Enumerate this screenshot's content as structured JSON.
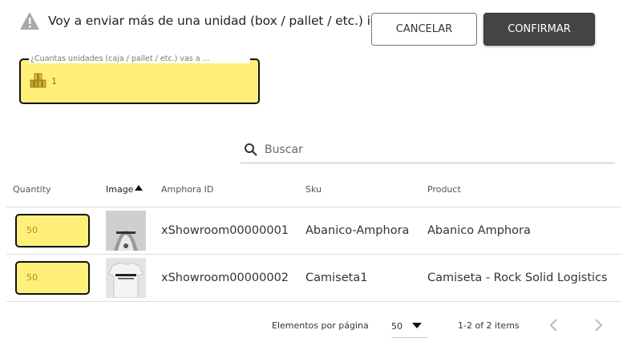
{
  "header": {
    "message": "Voy a enviar más de una unidad (box / pallet / etc.) igual.",
    "warning_icon": "warning-icon",
    "cancel_label": "CANCELAR",
    "confirm_label": "CONFIRMAR"
  },
  "units": {
    "label": "¿Cuantas unidades (caja / pallet / etc.) vas a ...",
    "value": "1",
    "icon": "boxes-icon"
  },
  "search": {
    "placeholder": "Buscar",
    "icon": "search-icon"
  },
  "table": {
    "columns": [
      "Quantity",
      "Image",
      "Amphora ID",
      "Sku",
      "Product"
    ],
    "sorted_column": "Image",
    "rows": [
      {
        "quantity": "50",
        "amphora_id": "xShowroom00000001",
        "sku": "Abanico-Amphora",
        "product": "Abanico Amphora"
      },
      {
        "quantity": "50",
        "amphora_id": "xShowroom00000002",
        "sku": "Camiseta1",
        "product": "Camiseta - Rock Solid Logistics"
      }
    ]
  },
  "pager": {
    "label": "Elementos por página",
    "per_page": "50",
    "range": "1-2 of 2 items"
  },
  "colors": {
    "field_yellow": "#fff07a",
    "confirm_bg": "#444444"
  }
}
